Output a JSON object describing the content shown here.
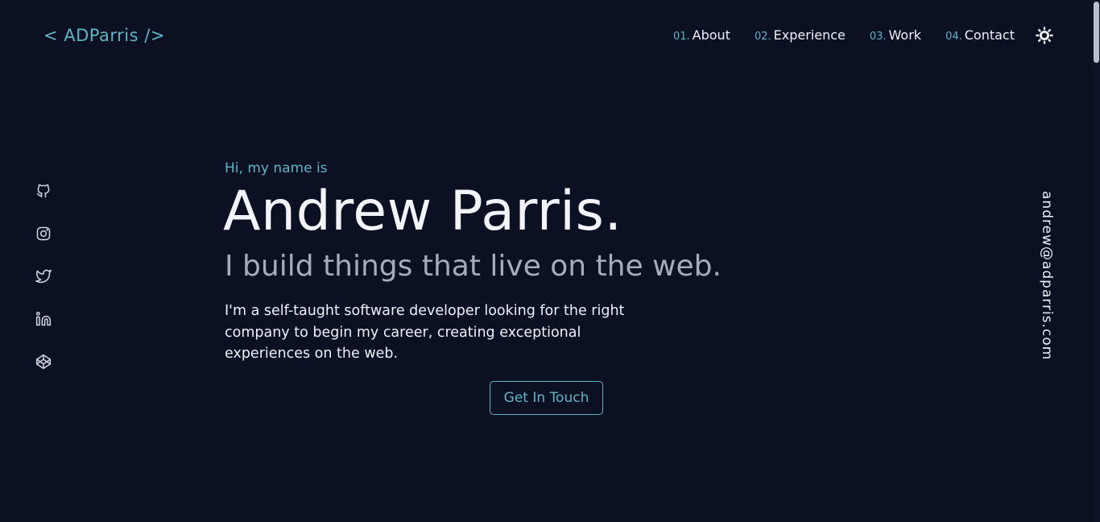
{
  "header": {
    "logo": "< ADParris />",
    "nav": [
      {
        "num": "01.",
        "label": "About"
      },
      {
        "num": "02.",
        "label": "Experience"
      },
      {
        "num": "03.",
        "label": "Work"
      },
      {
        "num": "04.",
        "label": "Contact"
      }
    ],
    "theme_toggle_icon": "sun-icon"
  },
  "social": {
    "icons": [
      "github-icon",
      "instagram-icon",
      "twitter-icon",
      "linkedin-icon",
      "codepen-icon"
    ]
  },
  "email": "andrew@adparris.com",
  "hero": {
    "greeting": "Hi, my name is",
    "name": "Andrew Parris.",
    "tagline": "I build things that live on the web.",
    "bio": "I'm a self-taught software developer looking for the right company to begin my career, creating exceptional experiences on the web.",
    "cta": "Get In Touch"
  },
  "colors": {
    "background": "#0b1022",
    "accent": "#5fb4c4",
    "text": "#eef1f8",
    "muted": "#a7acbc"
  }
}
